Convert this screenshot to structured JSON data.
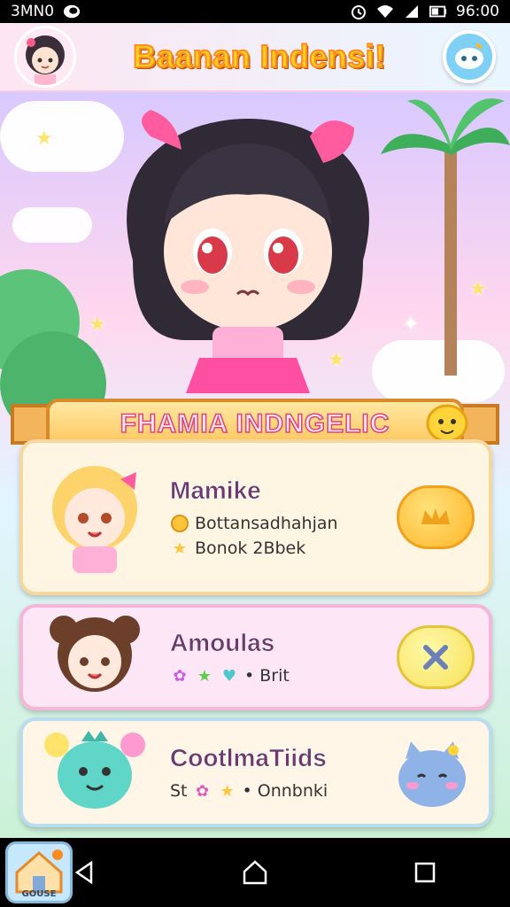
{
  "status_bar": {
    "carrier": "3MN0",
    "time": "96:00"
  },
  "header": {
    "title": "Baanan Indensi!"
  },
  "banner": {
    "title": "FHAMIA INDNGELIC"
  },
  "cards": [
    {
      "name": "Mamike",
      "line1": "Bottansadhahjan",
      "line2": "Bonok 2Bbek"
    },
    {
      "name": "Amoulas",
      "line1": "• Brit"
    },
    {
      "name": "CootlmaTiids",
      "prefix": "St",
      "suffix": "• Onnbnki"
    }
  ],
  "home_app": {
    "label": "GOUSE"
  },
  "colors": {
    "accent": "#ff8a1f",
    "title_fill": "#ffd21f",
    "banner_stroke": "#e04378"
  },
  "icons": [
    "status-dot",
    "wifi-icon",
    "signal-icon",
    "battery-icon",
    "back-icon",
    "home-icon",
    "recents-icon",
    "cloud-icon",
    "star-icon"
  ]
}
